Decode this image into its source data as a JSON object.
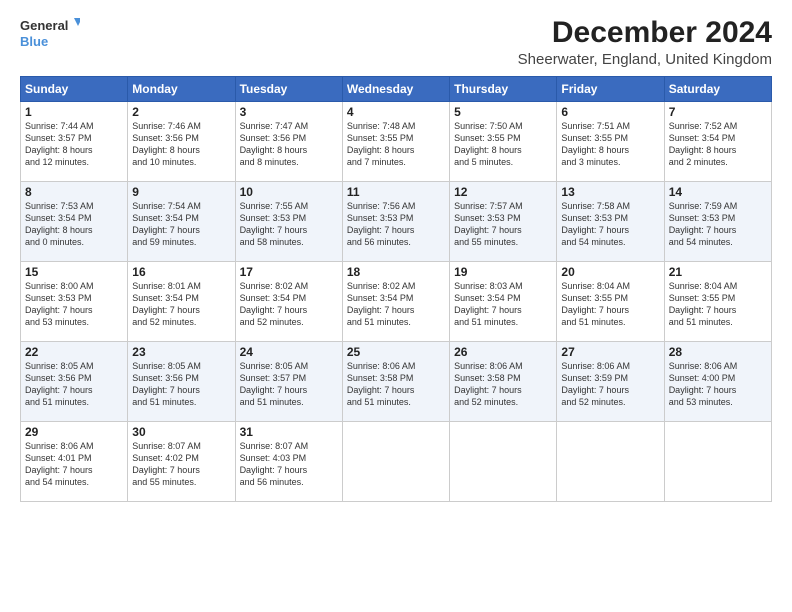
{
  "logo": {
    "general": "General",
    "blue": "Blue"
  },
  "title": "December 2024",
  "subtitle": "Sheerwater, England, United Kingdom",
  "days_header": [
    "Sunday",
    "Monday",
    "Tuesday",
    "Wednesday",
    "Thursday",
    "Friday",
    "Saturday"
  ],
  "weeks": [
    [
      {
        "day": "1",
        "info": "Sunrise: 7:44 AM\nSunset: 3:57 PM\nDaylight: 8 hours\nand 12 minutes."
      },
      {
        "day": "2",
        "info": "Sunrise: 7:46 AM\nSunset: 3:56 PM\nDaylight: 8 hours\nand 10 minutes."
      },
      {
        "day": "3",
        "info": "Sunrise: 7:47 AM\nSunset: 3:56 PM\nDaylight: 8 hours\nand 8 minutes."
      },
      {
        "day": "4",
        "info": "Sunrise: 7:48 AM\nSunset: 3:55 PM\nDaylight: 8 hours\nand 7 minutes."
      },
      {
        "day": "5",
        "info": "Sunrise: 7:50 AM\nSunset: 3:55 PM\nDaylight: 8 hours\nand 5 minutes."
      },
      {
        "day": "6",
        "info": "Sunrise: 7:51 AM\nSunset: 3:55 PM\nDaylight: 8 hours\nand 3 minutes."
      },
      {
        "day": "7",
        "info": "Sunrise: 7:52 AM\nSunset: 3:54 PM\nDaylight: 8 hours\nand 2 minutes."
      }
    ],
    [
      {
        "day": "8",
        "info": "Sunrise: 7:53 AM\nSunset: 3:54 PM\nDaylight: 8 hours\nand 0 minutes."
      },
      {
        "day": "9",
        "info": "Sunrise: 7:54 AM\nSunset: 3:54 PM\nDaylight: 7 hours\nand 59 minutes."
      },
      {
        "day": "10",
        "info": "Sunrise: 7:55 AM\nSunset: 3:53 PM\nDaylight: 7 hours\nand 58 minutes."
      },
      {
        "day": "11",
        "info": "Sunrise: 7:56 AM\nSunset: 3:53 PM\nDaylight: 7 hours\nand 56 minutes."
      },
      {
        "day": "12",
        "info": "Sunrise: 7:57 AM\nSunset: 3:53 PM\nDaylight: 7 hours\nand 55 minutes."
      },
      {
        "day": "13",
        "info": "Sunrise: 7:58 AM\nSunset: 3:53 PM\nDaylight: 7 hours\nand 54 minutes."
      },
      {
        "day": "14",
        "info": "Sunrise: 7:59 AM\nSunset: 3:53 PM\nDaylight: 7 hours\nand 54 minutes."
      }
    ],
    [
      {
        "day": "15",
        "info": "Sunrise: 8:00 AM\nSunset: 3:53 PM\nDaylight: 7 hours\nand 53 minutes."
      },
      {
        "day": "16",
        "info": "Sunrise: 8:01 AM\nSunset: 3:54 PM\nDaylight: 7 hours\nand 52 minutes."
      },
      {
        "day": "17",
        "info": "Sunrise: 8:02 AM\nSunset: 3:54 PM\nDaylight: 7 hours\nand 52 minutes."
      },
      {
        "day": "18",
        "info": "Sunrise: 8:02 AM\nSunset: 3:54 PM\nDaylight: 7 hours\nand 51 minutes."
      },
      {
        "day": "19",
        "info": "Sunrise: 8:03 AM\nSunset: 3:54 PM\nDaylight: 7 hours\nand 51 minutes."
      },
      {
        "day": "20",
        "info": "Sunrise: 8:04 AM\nSunset: 3:55 PM\nDaylight: 7 hours\nand 51 minutes."
      },
      {
        "day": "21",
        "info": "Sunrise: 8:04 AM\nSunset: 3:55 PM\nDaylight: 7 hours\nand 51 minutes."
      }
    ],
    [
      {
        "day": "22",
        "info": "Sunrise: 8:05 AM\nSunset: 3:56 PM\nDaylight: 7 hours\nand 51 minutes."
      },
      {
        "day": "23",
        "info": "Sunrise: 8:05 AM\nSunset: 3:56 PM\nDaylight: 7 hours\nand 51 minutes."
      },
      {
        "day": "24",
        "info": "Sunrise: 8:05 AM\nSunset: 3:57 PM\nDaylight: 7 hours\nand 51 minutes."
      },
      {
        "day": "25",
        "info": "Sunrise: 8:06 AM\nSunset: 3:58 PM\nDaylight: 7 hours\nand 51 minutes."
      },
      {
        "day": "26",
        "info": "Sunrise: 8:06 AM\nSunset: 3:58 PM\nDaylight: 7 hours\nand 52 minutes."
      },
      {
        "day": "27",
        "info": "Sunrise: 8:06 AM\nSunset: 3:59 PM\nDaylight: 7 hours\nand 52 minutes."
      },
      {
        "day": "28",
        "info": "Sunrise: 8:06 AM\nSunset: 4:00 PM\nDaylight: 7 hours\nand 53 minutes."
      }
    ],
    [
      {
        "day": "29",
        "info": "Sunrise: 8:06 AM\nSunset: 4:01 PM\nDaylight: 7 hours\nand 54 minutes."
      },
      {
        "day": "30",
        "info": "Sunrise: 8:07 AM\nSunset: 4:02 PM\nDaylight: 7 hours\nand 55 minutes."
      },
      {
        "day": "31",
        "info": "Sunrise: 8:07 AM\nSunset: 4:03 PM\nDaylight: 7 hours\nand 56 minutes."
      },
      null,
      null,
      null,
      null
    ]
  ]
}
